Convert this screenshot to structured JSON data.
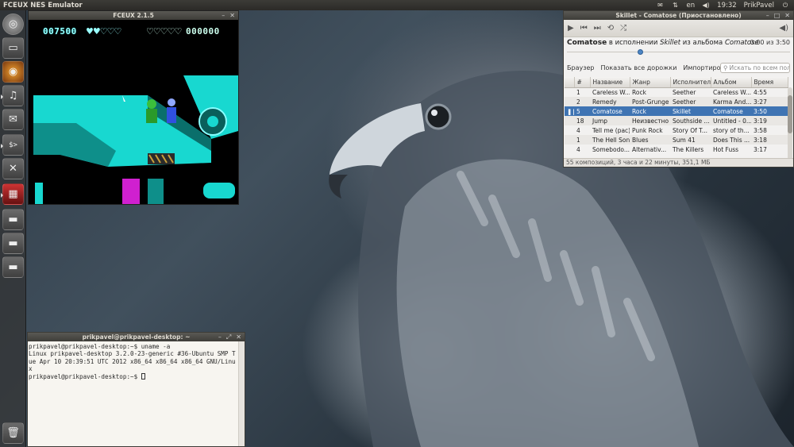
{
  "panel": {
    "app_title": "FCEUX NES Emulator",
    "keyboard": "en",
    "clock": "19:32",
    "user": "PrikPavel"
  },
  "launcher": {
    "items": [
      {
        "name": "dash",
        "glyph": "◎"
      },
      {
        "name": "home-folder",
        "glyph": "▭"
      },
      {
        "name": "firefox",
        "glyph": "◉"
      },
      {
        "name": "music-player",
        "glyph": "♫"
      },
      {
        "name": "thunderbird",
        "glyph": "✉"
      },
      {
        "name": "terminal",
        "glyph": "$>"
      },
      {
        "name": "system-settings",
        "glyph": "✕"
      },
      {
        "name": "fceux",
        "glyph": "▦"
      },
      {
        "name": "drive-1",
        "glyph": "▬"
      },
      {
        "name": "drive-2",
        "glyph": "▬"
      },
      {
        "name": "drive-3",
        "glyph": "▬"
      },
      {
        "name": "trash",
        "glyph": "🗑"
      }
    ]
  },
  "fceux": {
    "title": "FCEUX 2.1.5",
    "p1_score": "007500",
    "p1_hearts": "♥♥♡♡♡",
    "p2_hearts": "♡♡♡♡♡",
    "p2_score": "000000"
  },
  "music": {
    "title": "Skillet - Comatose (Приостановлено)",
    "now_title": "Comatose",
    "now_by": "в исполнении",
    "now_artist": "Skillet",
    "now_from": "из альбома",
    "now_album": "Comatose",
    "time": "0:00 из 3:50",
    "links": [
      "Браузер",
      "Показать все дорожки",
      "Импортировать"
    ],
    "search_placeholder": "Искать по всем поля",
    "columns": [
      "",
      "#",
      "Название",
      "Жанр",
      "Исполнитель",
      "Альбом",
      "Время"
    ],
    "rows": [
      {
        "state": "",
        "num": "1",
        "title": "Careless W...",
        "genre": "Rock",
        "artist": "Seether",
        "album": "Careless W...",
        "time": "4:55"
      },
      {
        "state": "",
        "num": "2",
        "title": "Remedy",
        "genre": "Post-Grunge",
        "artist": "Seether",
        "album": "Karma And...",
        "time": "3:27"
      },
      {
        "state": "❚❚",
        "num": "5",
        "title": "Comatose",
        "genre": "Rock",
        "artist": "Skillet",
        "album": "Comatose",
        "time": "3:50"
      },
      {
        "state": "",
        "num": "18",
        "title": "Jump",
        "genre": "Неизвестно",
        "artist": "Southside ...",
        "album": "Untitled - 0...",
        "time": "3:19"
      },
      {
        "state": "",
        "num": "4",
        "title": "Tell me (pac)",
        "genre": "Punk Rock",
        "artist": "Story Of T...",
        "album": "story of th...",
        "time": "3:58"
      },
      {
        "state": "",
        "num": "1",
        "title": "The Hell Song",
        "genre": "Blues",
        "artist": "Sum 41",
        "album": "Does This ...",
        "time": "3:18"
      },
      {
        "state": "",
        "num": "4",
        "title": "Somebodo...",
        "genre": "Alternativ...",
        "artist": "The Killers",
        "album": "Hot Fuss",
        "time": "3:17"
      }
    ],
    "status": "55 композиций, 3 часа и 22 минуты, 351,1 МБ"
  },
  "terminal": {
    "title": "prikpavel@prikpavel-desktop: ~",
    "lines": [
      "prikpavel@prikpavel-desktop:~$ uname -a",
      "Linux prikpavel-desktop 3.2.0-23-generic #36-Ubuntu SMP Tue Apr 10 20:39:51 UTC 2012 x86_64 x86_64 x86_64 GNU/Linux",
      "prikpavel@prikpavel-desktop:~$ "
    ]
  },
  "colors": {
    "panel": "#3c3b37",
    "selected_row": "#3f74b3",
    "game_cyan": "#18d8d0"
  }
}
